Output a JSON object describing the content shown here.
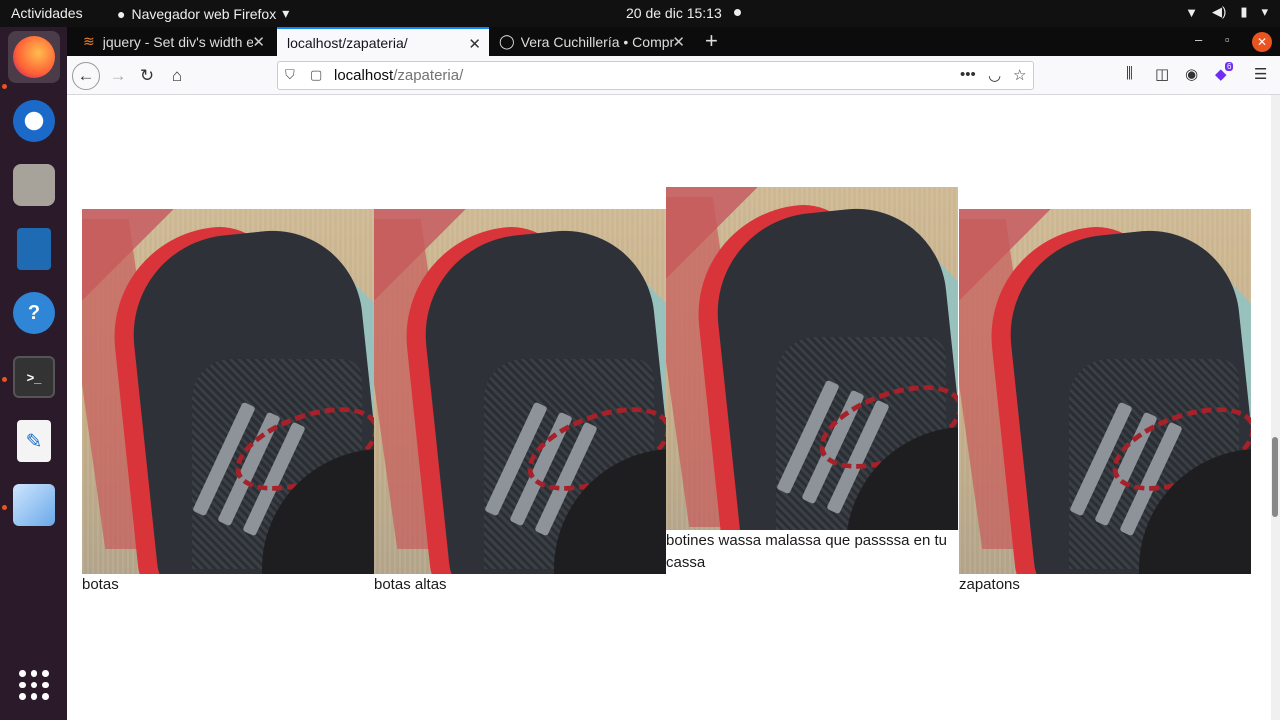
{
  "topbar": {
    "activities": "Actividades",
    "app_menu": "Navegador web Firefox",
    "clock": "20 de dic  15:13"
  },
  "tabs": [
    {
      "title": "jquery - Set div's width e"
    },
    {
      "title": "localhost/zapateria/"
    },
    {
      "title": "Vera Cuchillería • Compr"
    }
  ],
  "urlbar": {
    "host": "localhost",
    "path": "/zapateria/"
  },
  "extensions": {
    "badge_count": "6"
  },
  "products": [
    {
      "name": "botas"
    },
    {
      "name": "botas altas"
    },
    {
      "name": "botines wassa malassa que passssa en tu cassa"
    },
    {
      "name": "zapatons"
    }
  ],
  "colors": {
    "dock_bg": "#2b1a2a",
    "accent": "#e95420",
    "tab_highlight": "#0a84ff"
  }
}
